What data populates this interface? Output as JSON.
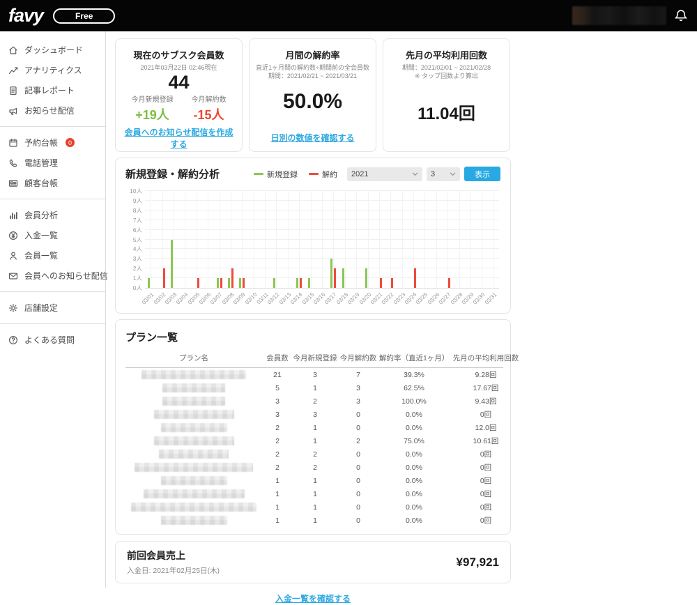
{
  "topbar": {
    "logo": "favy",
    "plan_badge": "Free"
  },
  "sidebar": {
    "groups": [
      {
        "items": [
          {
            "icon": "home-icon",
            "label": "ダッシュボード"
          },
          {
            "icon": "analytics-icon",
            "label": "アナリティクス"
          },
          {
            "icon": "article-icon",
            "label": "記事レポート"
          },
          {
            "icon": "megaphone-icon",
            "label": "お知らせ配信"
          }
        ]
      },
      {
        "items": [
          {
            "icon": "calendar-icon",
            "label": "予約台帳",
            "badge": "0"
          },
          {
            "icon": "phone-icon",
            "label": "電話管理"
          },
          {
            "icon": "ledger-icon",
            "label": "顧客台帳"
          }
        ]
      },
      {
        "items": [
          {
            "icon": "bar-chart-icon",
            "label": "会員分析"
          },
          {
            "icon": "yen-icon",
            "label": "入金一覧"
          },
          {
            "icon": "person-icon",
            "label": "会員一覧"
          },
          {
            "icon": "mail-icon",
            "label": "会員へのお知らせ配信"
          }
        ]
      },
      {
        "items": [
          {
            "icon": "gear-icon",
            "label": "店舗設定"
          }
        ]
      },
      {
        "items": [
          {
            "icon": "question-icon",
            "label": "よくある質問"
          }
        ]
      }
    ]
  },
  "cards": {
    "members": {
      "title": "現在のサブスク会員数",
      "subtitle": "2021年03月22日 02:46現在",
      "value": "44",
      "new_label": "今月新規登録",
      "new_value": "+19人",
      "cancel_label": "今月解約数",
      "cancel_value": "-15人",
      "link": "会員へのお知らせ配信を作成する"
    },
    "churn": {
      "title": "月間の解約率",
      "subtitle1": "直近1ヶ月間の解約数÷期間前の全会員数",
      "subtitle2": "期間：2021/02/21 ~ 2021/03/21",
      "value": "50.0%",
      "link": "日別の数値を確認する"
    },
    "usage": {
      "title": "先月の平均利用回数",
      "subtitle1": "期間：2021/02/01 ~ 2021/02/28",
      "subtitle2": "※ タップ回数より算出",
      "value": "11.04回"
    }
  },
  "analysis": {
    "title": "新規登録・解約分析",
    "year": "2021",
    "month": "3",
    "show_button": "表示"
  },
  "chart_data": {
    "type": "bar",
    "title": "新規登録・解約分析",
    "categories": [
      "03/01",
      "03/02",
      "03/03",
      "03/04",
      "03/05",
      "03/06",
      "03/07",
      "03/08",
      "03/09",
      "03/10",
      "03/11",
      "03/12",
      "03/13",
      "03/14",
      "03/15",
      "03/16",
      "03/17",
      "03/18",
      "03/19",
      "03/20",
      "03/21",
      "03/22",
      "03/23",
      "03/24",
      "03/25",
      "03/26",
      "03/27",
      "03/28",
      "03/29",
      "03/30",
      "03/31"
    ],
    "series": [
      {
        "name": "新規登録",
        "color": "#8bc653",
        "values": [
          1,
          0,
          5,
          0,
          0,
          0,
          1,
          1,
          1,
          0,
          0,
          1,
          0,
          1,
          1,
          0,
          3,
          2,
          0,
          2,
          0,
          0,
          0,
          0,
          0,
          0,
          0,
          0,
          0,
          0,
          0
        ]
      },
      {
        "name": "解約",
        "color": "#ef4b3a",
        "values": [
          0,
          2,
          0,
          0,
          1,
          0,
          1,
          2,
          1,
          0,
          0,
          0,
          0,
          1,
          0,
          0,
          2,
          0,
          0,
          0,
          1,
          1,
          0,
          2,
          0,
          0,
          1,
          0,
          0,
          0,
          0
        ]
      }
    ],
    "ylim": [
      0,
      10
    ],
    "ytick_step": 1,
    "ytick_suffix": "人",
    "grid": true,
    "legend_position": "top-right"
  },
  "plans": {
    "title": "プラン一覧",
    "headers": [
      "プラン名",
      "会員数",
      "今月新規登録",
      "今月解約数",
      "解約率（直近1ヶ月）",
      "先月の平均利用回数"
    ],
    "rows": [
      {
        "members": "21",
        "new": "3",
        "cancel": "7",
        "rate": "39.3%",
        "usage": "9.28回"
      },
      {
        "members": "5",
        "new": "1",
        "cancel": "3",
        "rate": "62.5%",
        "usage": "17.67回"
      },
      {
        "members": "3",
        "new": "2",
        "cancel": "3",
        "rate": "100.0%",
        "usage": "9.43回"
      },
      {
        "members": "3",
        "new": "3",
        "cancel": "0",
        "rate": "0.0%",
        "usage": "0回"
      },
      {
        "members": "2",
        "new": "1",
        "cancel": "0",
        "rate": "0.0%",
        "usage": "12.0回"
      },
      {
        "members": "2",
        "new": "1",
        "cancel": "2",
        "rate": "75.0%",
        "usage": "10.61回"
      },
      {
        "members": "2",
        "new": "2",
        "cancel": "0",
        "rate": "0.0%",
        "usage": "0回"
      },
      {
        "members": "2",
        "new": "2",
        "cancel": "0",
        "rate": "0.0%",
        "usage": "0回"
      },
      {
        "members": "1",
        "new": "1",
        "cancel": "0",
        "rate": "0.0%",
        "usage": "0回"
      },
      {
        "members": "1",
        "new": "1",
        "cancel": "0",
        "rate": "0.0%",
        "usage": "0回"
      },
      {
        "members": "1",
        "new": "1",
        "cancel": "0",
        "rate": "0.0%",
        "usage": "0回"
      },
      {
        "members": "1",
        "new": "1",
        "cancel": "0",
        "rate": "0.0%",
        "usage": "0回"
      }
    ]
  },
  "revenue": {
    "title": "前回会員売上",
    "date": "入金日: 2021年02月25日(木)",
    "amount": "¥97,921"
  },
  "footer_link": "入金一覧を確認する",
  "colors": {
    "accent_blue": "#29a9e2",
    "green": "#8bc653",
    "red": "#ef4b3a"
  }
}
